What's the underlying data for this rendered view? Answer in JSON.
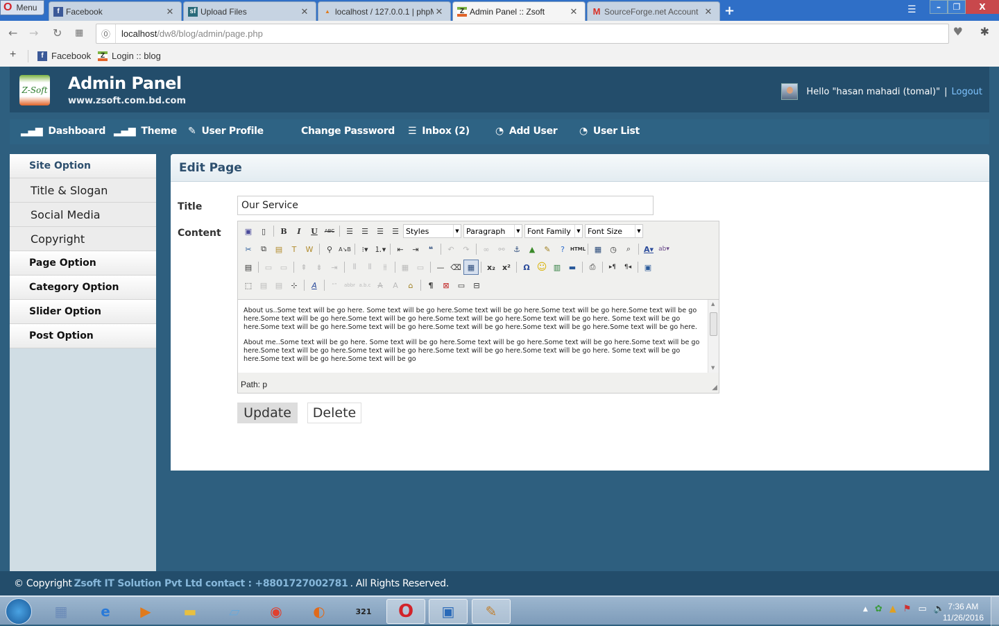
{
  "browser": {
    "menu_label": "Menu",
    "tabs": [
      {
        "label": "Facebook",
        "icon": "facebook-icon",
        "active": false
      },
      {
        "label": "Upload Files",
        "icon": "sourceforge-icon",
        "active": false
      },
      {
        "label": "localhost / 127.0.0.1 | phpM",
        "icon": "phpmyadmin-icon",
        "active": false
      },
      {
        "label": "Admin Panel :: Zsoft",
        "icon": "zsoft-icon",
        "active": true
      },
      {
        "label": "SourceForge.net Account",
        "icon": "gmail-icon",
        "active": false
      }
    ],
    "new_tab_symbol": "+",
    "url_host": "localhost",
    "url_path": "/dw8/blog/admin/page.php",
    "adblock_count": "0",
    "bookmarks": [
      {
        "label": "Facebook",
        "icon": "facebook-icon"
      },
      {
        "label": "Login :: blog",
        "icon": "zsoft-icon"
      }
    ]
  },
  "header": {
    "title": "Admin Panel",
    "url": "www.zsoft.com.bd.com",
    "greeting": "Hello \"hasan mahadi (tomal)\"",
    "separator": "|",
    "logout_label": "Logout",
    "logo_text": "Z-Soft"
  },
  "nav": {
    "items": [
      {
        "label": "Dashboard",
        "icon": "bar-chart-icon"
      },
      {
        "label": "Theme",
        "icon": "bar-chart-icon"
      },
      {
        "label": "User Profile",
        "icon": "edit-icon"
      },
      {
        "label": "Change Password",
        "icon": ""
      },
      {
        "label": "Inbox (2)",
        "icon": "list-icon"
      },
      {
        "label": "Add User",
        "icon": "user-icon"
      },
      {
        "label": "User List",
        "icon": "user-icon"
      }
    ]
  },
  "sidebar": {
    "items": [
      {
        "label": "Site Option",
        "type": "head"
      },
      {
        "label": "Title & Slogan",
        "type": "sub"
      },
      {
        "label": "Social Media",
        "type": "sub"
      },
      {
        "label": "Copyright",
        "type": "sub"
      },
      {
        "label": "Page Option",
        "type": "head"
      },
      {
        "label": "Category Option",
        "type": "head"
      },
      {
        "label": "Slider Option",
        "type": "head"
      },
      {
        "label": "Post Option",
        "type": "head"
      }
    ]
  },
  "main": {
    "heading": "Edit Page",
    "title_label": "Title",
    "title_value": "Our Service",
    "content_label": "Content",
    "editor": {
      "styles_select": "Styles",
      "format_select": "Paragraph",
      "font_family_select": "Font Family",
      "font_size_select": "Font Size",
      "paragraphs": [
        "About us..Some text will be go here. Some text will be go here.Some text will be go here.Some text will be go here.Some text will be go here.Some text will be go here.Some text will be go here.Some text will be go here.Some text will be go here. Some text will be go here.Some text will be go here.Some text will be go here.Some text will be go here.Some text will be go here.Some text will be go here.",
        "About me..Some text will be go here. Some text will be go here.Some text will be go here.Some text will be go here.Some text will be go here.Some text will be go here.Some text will be go here.Some text will be go here.Some text will be go here. Some text will be go here.Some text will be go here.Some text will be go"
      ],
      "path": "Path: p"
    },
    "update_label": "Update",
    "delete_label": "Delete"
  },
  "footer": {
    "prefix": "© Copyright",
    "company": "Zsoft IT Solution Pvt Ltd contact : +8801727002781",
    "suffix": ". All Rights Reserved."
  },
  "taskbar": {
    "apps": [
      "calculator-icon",
      "internet-explorer-icon",
      "media-player-icon",
      "file-explorer-icon",
      "notepad-icon",
      "chrome-icon",
      "firefox-icon",
      "media-player-classic-icon",
      "opera-icon",
      "control-panel-icon",
      "paint-icon"
    ],
    "time": "7:36 AM",
    "date": "11/26/2016"
  }
}
